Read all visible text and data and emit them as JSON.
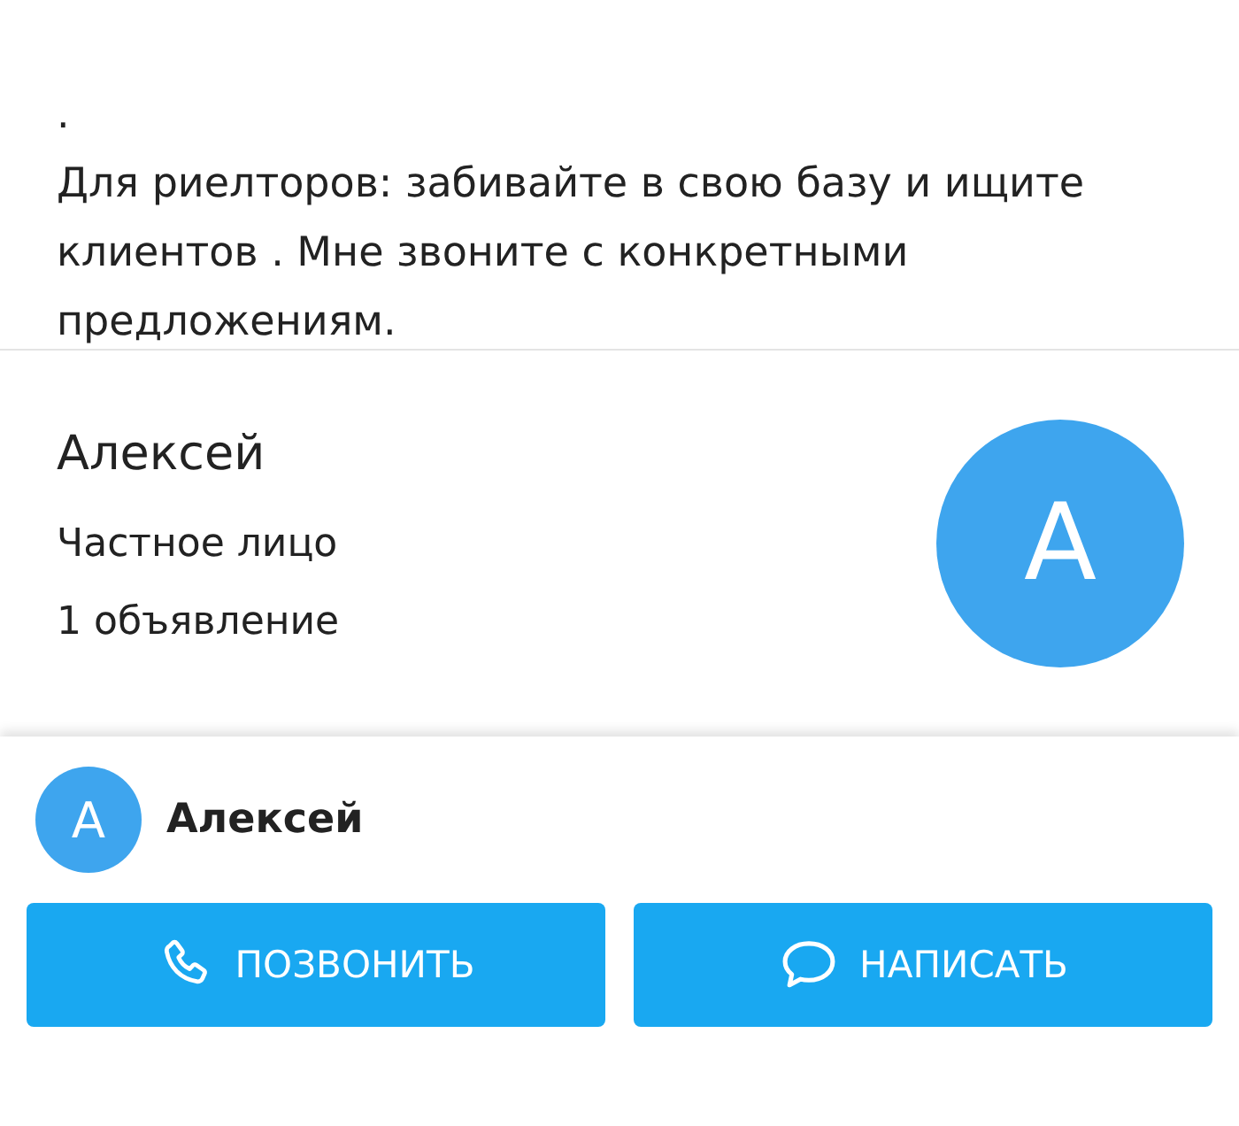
{
  "description": {
    "lines": [
      ".",
      "Для риелторов: забивайте в свою базу и ищите клиентов . Мне звоните с конкретными предложениям."
    ]
  },
  "seller": {
    "name": "Алексей",
    "type": "Частное лицо",
    "ads": "1 объявление",
    "avatar_letter": "А"
  },
  "bottom_bar": {
    "avatar_letter": "А",
    "name": "Алексей"
  },
  "buttons": [
    {
      "kind": "call",
      "label": "ПОЗВОНИТЬ"
    },
    {
      "kind": "message",
      "label": "НАПИСАТЬ"
    }
  ]
}
